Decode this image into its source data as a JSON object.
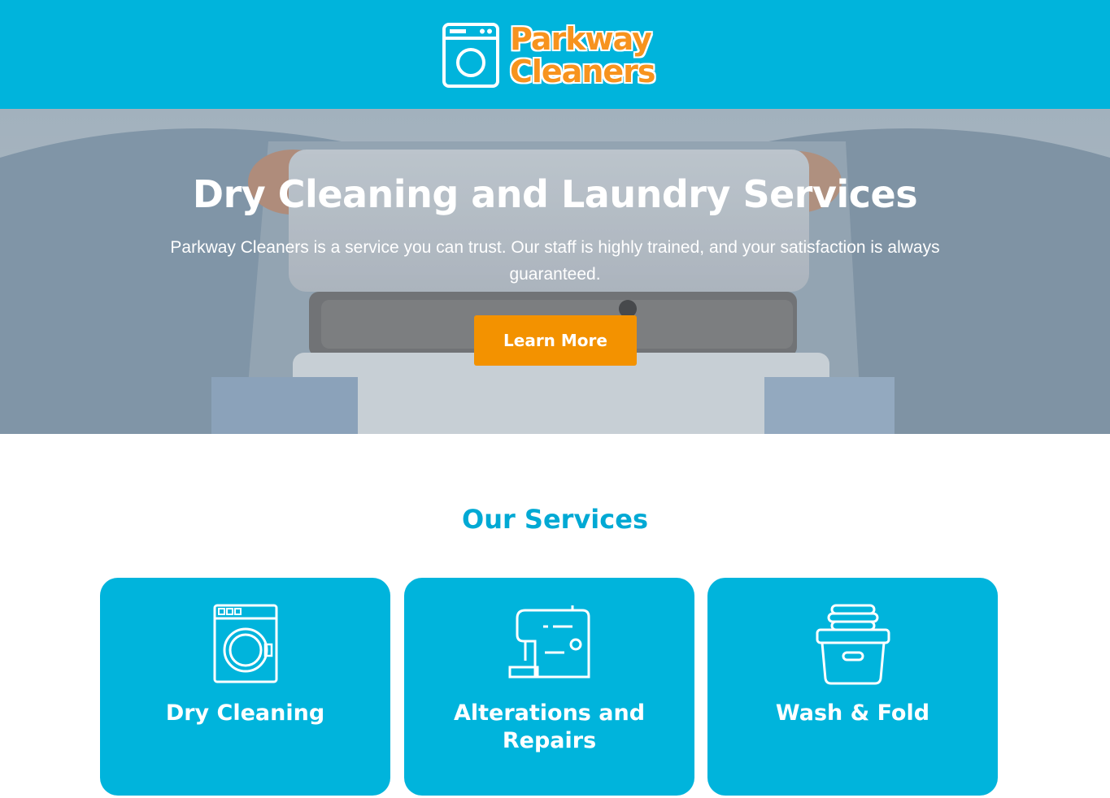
{
  "header": {
    "logo_line1": "Parkway",
    "logo_line2": "Cleaners",
    "logo_icon": "washing-machine-icon",
    "bg_color": "#00b4dc",
    "logo_text_color": "#f7931e"
  },
  "hero": {
    "title": "Dry Cleaning and Laundry Services",
    "subtitle": "Parkway Cleaners is a service you can trust. Our staff is highly trained, and your satisfaction is always guaranteed.",
    "button_label": "Learn More",
    "button_color": "#f39200"
  },
  "services": {
    "title": "Our Services",
    "title_color": "#00a9d4",
    "items": [
      {
        "label": "Dry Cleaning",
        "icon": "washing-machine-icon"
      },
      {
        "label": "Alterations and Repairs",
        "icon": "sewing-machine-icon"
      },
      {
        "label": "Wash & Fold",
        "icon": "laundry-basket-icon"
      }
    ]
  }
}
